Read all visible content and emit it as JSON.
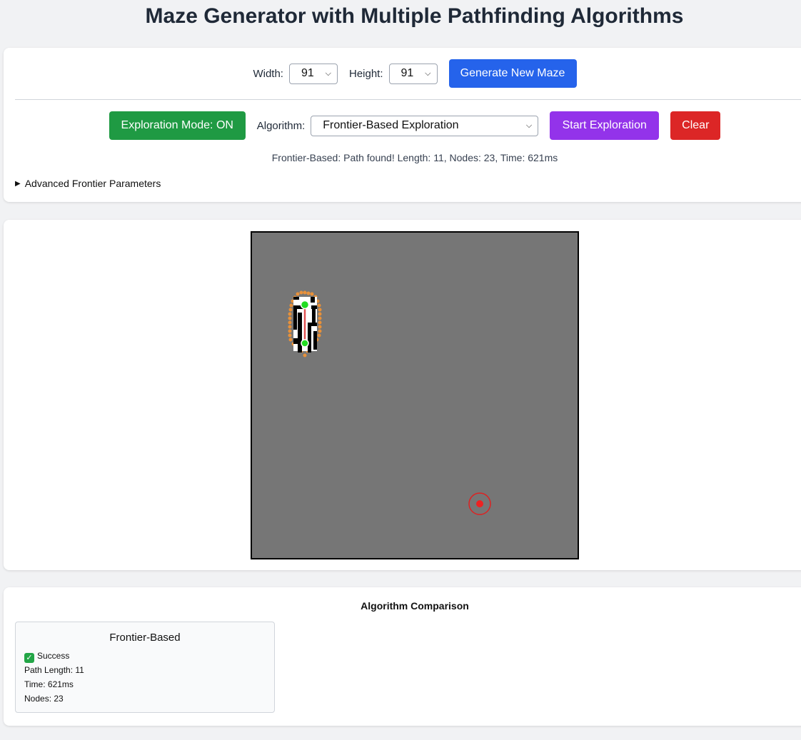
{
  "page_title": "Maze Generator with Multiple Pathfinding Algorithms",
  "size_controls": {
    "width_label": "Width:",
    "width_value": "91",
    "height_label": "Height:",
    "height_value": "91",
    "generate_label": "Generate New Maze"
  },
  "exploration": {
    "mode_label": "Exploration Mode: ON",
    "algorithm_label": "Algorithm:",
    "algorithm_value": "Frontier-Based Exploration",
    "start_label": "Start Exploration",
    "clear_label": "Clear"
  },
  "status_text": "Frontier-Based: Path found! Length: 11, Nodes: 23, Time: 621ms",
  "advanced_label": "Advanced Frontier Parameters",
  "comparison": {
    "title": "Algorithm Comparison",
    "cards": [
      {
        "name": "Frontier-Based",
        "status": "Success",
        "path_length": "Path Length: 11",
        "time": "Time: 621ms",
        "nodes": "Nodes: 23"
      }
    ]
  },
  "colors": {
    "generate_button": "#2563eb",
    "mode_button": "#16a34a",
    "start_button": "#9333ea",
    "clear_button": "#dc2626",
    "unexplored": "#767676",
    "frontier": "#e8913a",
    "path": "#e05252",
    "start_marker": "#22dd22",
    "goal_marker": "#ee2222"
  },
  "icons": {
    "success": "check-mark-icon",
    "select_arrow": "chevron-down-icon",
    "details_toggle": "triangle-right-icon"
  }
}
